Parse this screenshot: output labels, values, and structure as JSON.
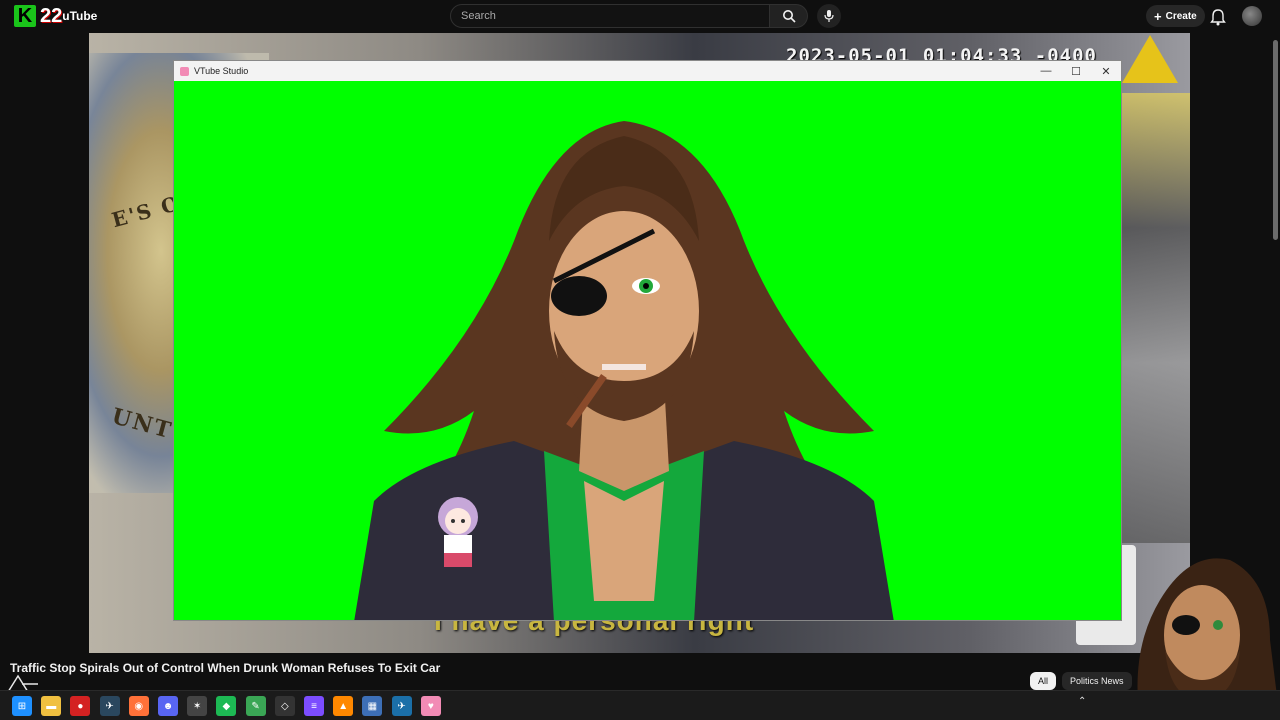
{
  "youtube": {
    "logo_text": "uTube",
    "logo_badge_number": "22",
    "logo_badge_letter": "K",
    "search_placeholder": "Search",
    "create_label": "Create"
  },
  "video": {
    "timestamp_overlay": "2023-05-01 01:04:33 -0400",
    "subtitle": "I have a personal right",
    "seal_text_top": "E'S OFF  OHNS",
    "seal_text_bottom": "UNTY",
    "title": "Traffic Stop Spirals Out of Control When Drunk Woman Refuses To Exit Car"
  },
  "vtube_window": {
    "title": "VTube Studio",
    "colors": {
      "chroma_key": "#00ff00",
      "hair": "#5a3620",
      "jacket": "#2e2c3a",
      "shirt": "#14a83c",
      "skin": "#c9966a"
    }
  },
  "chips": [
    {
      "label": "All",
      "active": true
    },
    {
      "label": "Politics News",
      "active": false
    }
  ],
  "taskbar": {
    "apps": [
      {
        "name": "start",
        "glyph": "⊞",
        "color": "#1e90ff"
      },
      {
        "name": "file-explorer",
        "glyph": "▬",
        "color": "#f0c040"
      },
      {
        "name": "recorder",
        "glyph": "●",
        "color": "#d42222"
      },
      {
        "name": "steam",
        "glyph": "✈",
        "color": "#2a475e"
      },
      {
        "name": "firefox",
        "glyph": "◉",
        "color": "#ff7139"
      },
      {
        "name": "discord",
        "glyph": "☻",
        "color": "#5865f2"
      },
      {
        "name": "game-app",
        "glyph": "✶",
        "color": "#444444"
      },
      {
        "name": "music-app",
        "glyph": "◆",
        "color": "#1db954"
      },
      {
        "name": "notepad",
        "glyph": "✎",
        "color": "#3aa655"
      },
      {
        "name": "app-diamond",
        "glyph": "◇",
        "color": "#333333"
      },
      {
        "name": "editor",
        "glyph": "≡",
        "color": "#7c4dff"
      },
      {
        "name": "vlc",
        "glyph": "▲",
        "color": "#ff8800"
      },
      {
        "name": "calculator",
        "glyph": "▦",
        "color": "#3d6fb6"
      },
      {
        "name": "steam-2",
        "glyph": "✈",
        "color": "#1b6fa8"
      },
      {
        "name": "vtube-studio",
        "glyph": "♥",
        "color": "#f28bb5"
      }
    ]
  }
}
